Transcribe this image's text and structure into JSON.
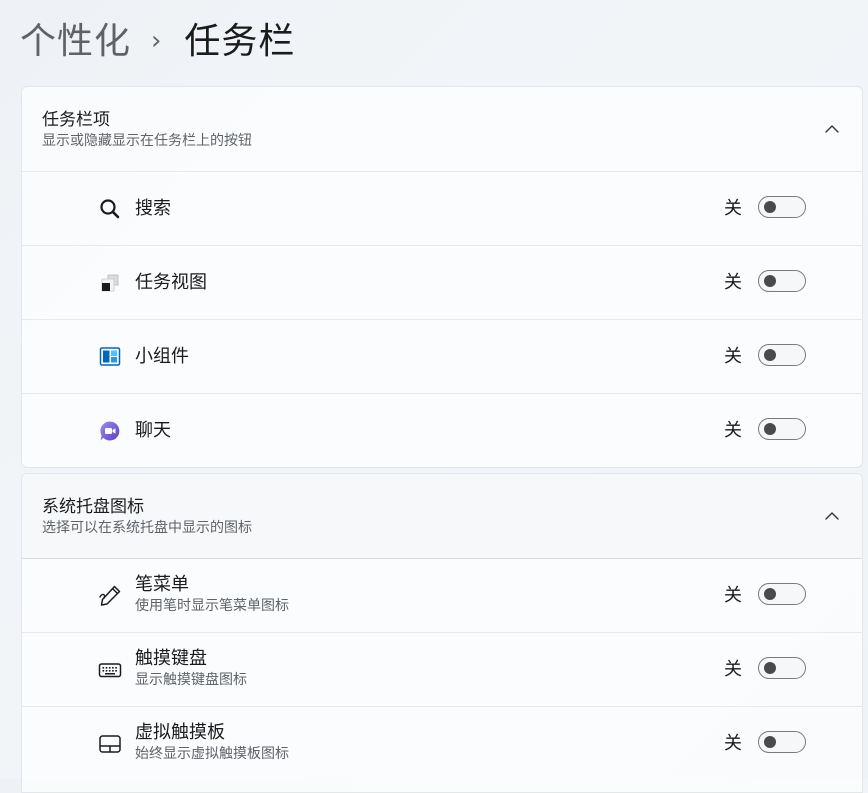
{
  "breadcrumb": {
    "parent": "个性化",
    "separator": "›",
    "current": "任务栏"
  },
  "taskbar_items": {
    "title": "任务栏项",
    "subtitle": "显示或隐藏显示在任务栏上的按钮",
    "items": [
      {
        "label": "搜索",
        "icon": "search-icon",
        "state": "关",
        "on": false
      },
      {
        "label": "任务视图",
        "icon": "task-view-icon",
        "state": "关",
        "on": false
      },
      {
        "label": "小组件",
        "icon": "widgets-icon",
        "state": "关",
        "on": false
      },
      {
        "label": "聊天",
        "icon": "chat-icon",
        "state": "关",
        "on": false
      }
    ]
  },
  "system_tray": {
    "title": "系统托盘图标",
    "subtitle": "选择可以在系统托盘中显示的图标",
    "items": [
      {
        "label": "笔菜单",
        "description": "使用笔时显示笔菜单图标",
        "icon": "pen-icon",
        "state": "关",
        "on": false
      },
      {
        "label": "触摸键盘",
        "description": "显示触摸键盘图标",
        "icon": "keyboard-icon",
        "state": "关",
        "on": false
      },
      {
        "label": "虚拟触摸板",
        "description": "始终显示虚拟触摸板图标",
        "icon": "touchpad-icon",
        "state": "关",
        "on": false
      }
    ]
  },
  "colors": {
    "accent_blue": "#0067c0",
    "widget_light": "#4cc2ff",
    "chat_purple": "#7b5cd6",
    "knob": "#4a4a4a"
  }
}
